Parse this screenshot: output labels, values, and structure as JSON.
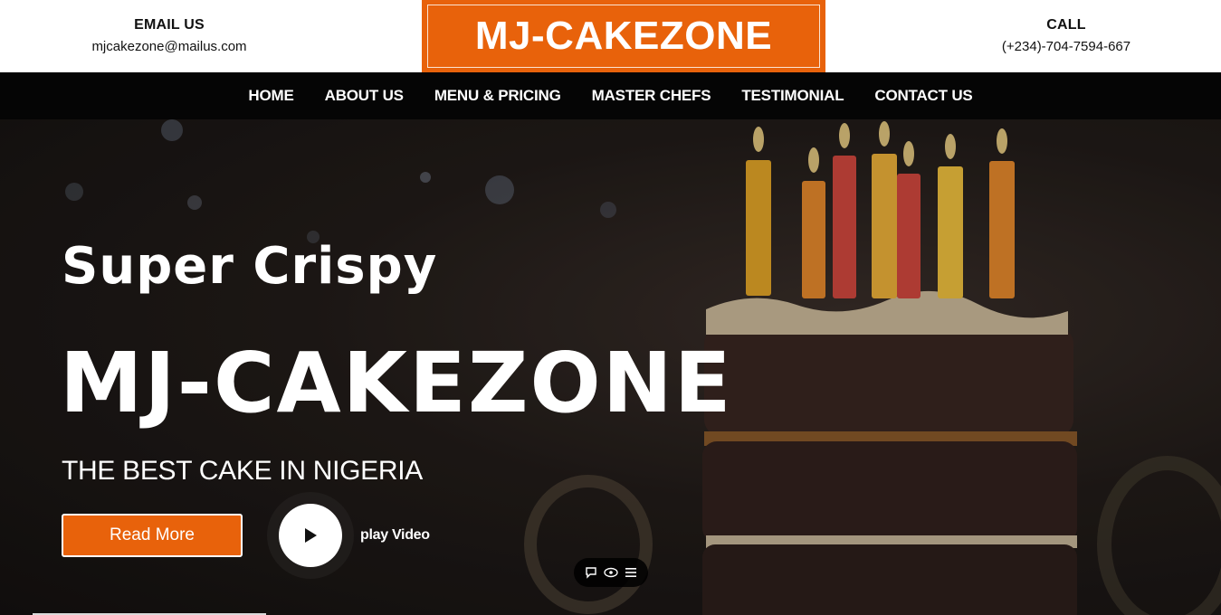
{
  "header": {
    "email": {
      "heading": "EMAIL US",
      "value": "mjcakezone@mailus.com"
    },
    "brand": "MJ-CAKEZONE",
    "call": {
      "heading": "CALL",
      "value": "(+234)-704-7594-667"
    }
  },
  "nav": {
    "items": [
      {
        "label": "HOME"
      },
      {
        "label": "ABOUT US"
      },
      {
        "label": "MENU & PRICING"
      },
      {
        "label": "MASTER CHEFS"
      },
      {
        "label": "TESTIMONIAL"
      },
      {
        "label": "CONTACT US"
      }
    ]
  },
  "hero": {
    "tagline": "Super Crispy",
    "title": "MJ-CAKEZONE",
    "subtitle": "THE BEST CAKE IN NIGERIA",
    "read_more_label": "Read More",
    "play_label": "play Video",
    "background_image": "birthday-cake-with-lit-candles"
  },
  "toolbar": {
    "icons": [
      "comment-icon",
      "eye-icon",
      "menu-icon"
    ]
  },
  "colors": {
    "accent": "#e8620b",
    "nav_background": "#050505",
    "header_background": "#ffffff"
  }
}
